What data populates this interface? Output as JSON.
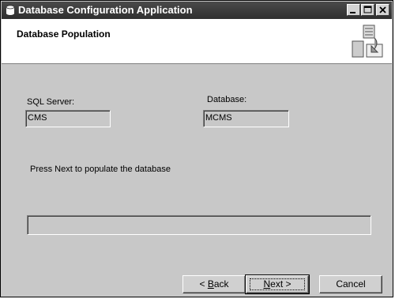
{
  "window": {
    "title": "Database Configuration Application",
    "controls": [
      "minimize",
      "maximize",
      "close"
    ]
  },
  "header": {
    "title": "Database Population"
  },
  "form": {
    "sql_server_label": "SQL Server:",
    "sql_server_value": "CMS",
    "database_label": "Database:",
    "database_value": "MCMS",
    "instruction": "Press Next to populate the database"
  },
  "progress": {
    "fraction": 0
  },
  "buttons": {
    "back": {
      "mnemonic": "B",
      "rest": "ack",
      "prefix": "< "
    },
    "next": {
      "mnemonic": "N",
      "rest": "ext",
      "suffix": " >"
    },
    "cancel": {
      "label": "Cancel"
    }
  },
  "colors": {
    "title_bar": "#3a3a3a",
    "dialog_bg": "#c8c8c8",
    "header_bg": "#ffffff"
  }
}
